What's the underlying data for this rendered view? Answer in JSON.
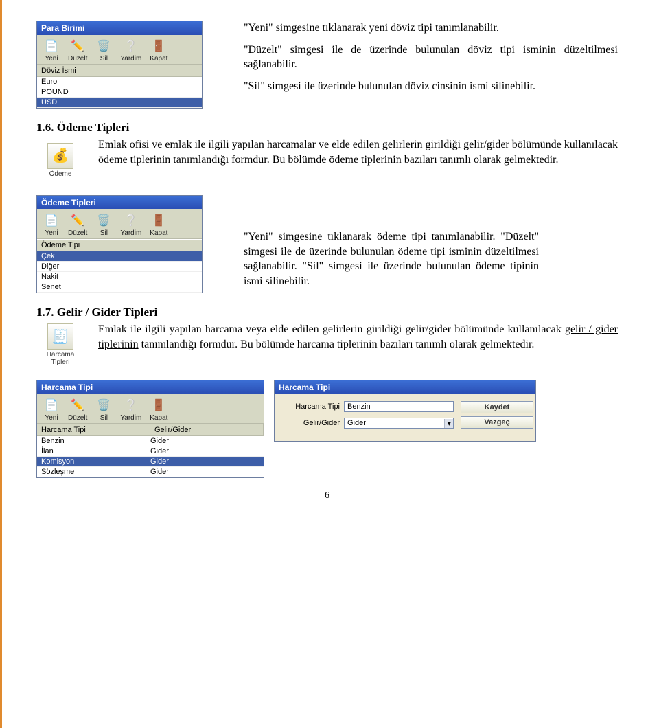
{
  "para1": "\"Yeni\" simgesine tıklanarak yeni döviz tipi tanımlanabilir.",
  "para2": "\"Düzelt\" simgesi ile de üzerinde bulunulan döviz tipi isminin düzeltilmesi sağlanabilir.",
  "para3": "\"Sil\" simgesi ile üzerinde bulunulan döviz cinsinin ismi silinebilir.",
  "window1": {
    "title": "Para Birimi",
    "list_header": "Döviz İsmi",
    "items": [
      "Euro",
      "POUND",
      "USD"
    ],
    "selected_index": 2
  },
  "toolbar": {
    "yeni": "Yeni",
    "duzelt": "Düzelt",
    "sil": "Sil",
    "yardim": "Yardim",
    "kapat": "Kapat"
  },
  "section16": {
    "heading": "1.6. Ödeme Tipleri",
    "text1": "Emlak ofisi ve emlak ile ilgili yapılan harcamalar ve elde edilen gelirlerin girildiği gelir/gider bölümünde kullanılacak ödeme tiplerinin tanımlandığı formdur. Bu bölümde ödeme tiplerinin bazıları tanımlı olarak gelmektedir.",
    "icon_label": "Ödeme"
  },
  "window2": {
    "title": "Ödeme Tipleri",
    "list_header": "Ödeme Tipi",
    "items": [
      "Çek",
      "Diğer",
      "Nakit",
      "Senet"
    ],
    "selected_index": 0
  },
  "para_odeme": "\"Yeni\" simgesine tıklanarak ödeme tipi tanımlanabilir. \"Düzelt\" simgesi ile de üzerinde bulunulan ödeme tipi isminin düzeltilmesi sağlanabilir. \"Sil\" simgesi ile üzerinde bulunulan ödeme tipinin ismi silinebilir.",
  "section17": {
    "heading": "1.7. Gelir / Gider Tipleri",
    "text_pre": "Emlak ile ilgili yapılan harcama veya elde edilen gelirlerin girildiği gelir/gider bölümünde kullanılacak ",
    "text_link": "gelir / gider tiplerinin",
    "text_post": " tanımlandığı formdur. Bu bölümde harcama tiplerinin bazıları tanımlı olarak gelmektedir.",
    "icon_label": "Harcama Tipleri"
  },
  "window3": {
    "title": "Harcama Tipi",
    "col1": "Harcama Tipi",
    "col2": "Gelir/Gider",
    "rows": [
      {
        "c1": "Benzin",
        "c2": "Gider"
      },
      {
        "c1": "İlan",
        "c2": "Gider"
      },
      {
        "c1": "Komisyon",
        "c2": "Gider"
      },
      {
        "c1": "Sözleşme",
        "c2": "Gider"
      }
    ],
    "selected_index": 2
  },
  "panel1": {
    "title": "Harcama Tipi",
    "field1_label": "Harcama Tipi",
    "field1_value": "Benzin",
    "field2_label": "Gelir/Gider",
    "field2_value": "Gider",
    "btn_save": "Kaydet",
    "btn_cancel": "Vazgeç"
  },
  "page_number": "6"
}
